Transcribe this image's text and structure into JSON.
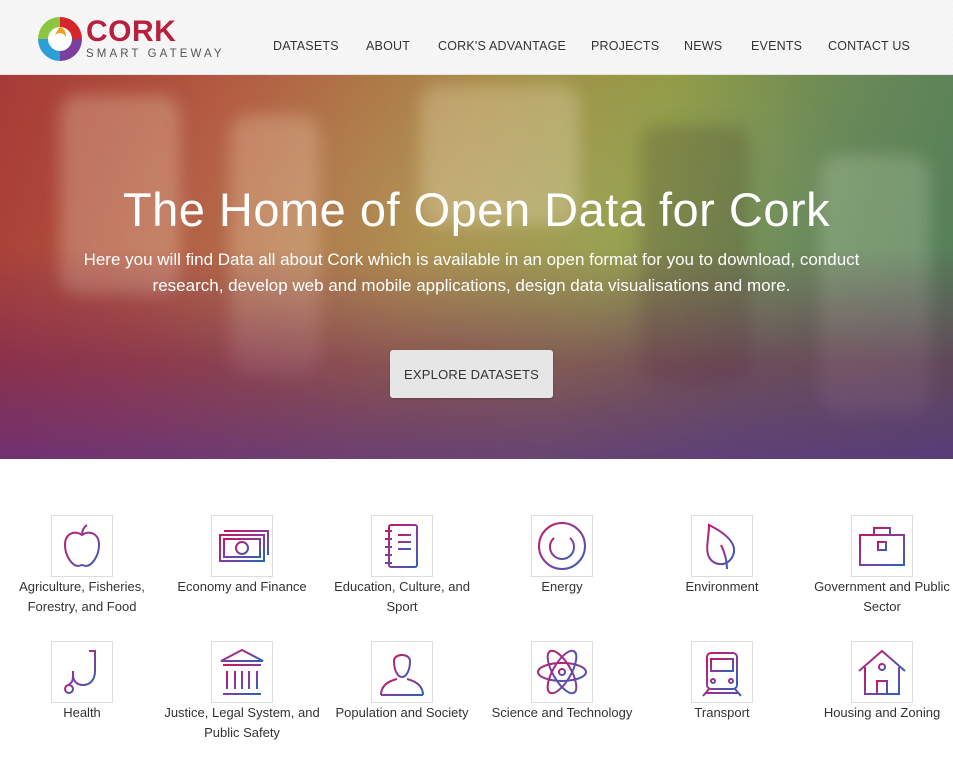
{
  "header": {
    "logo": {
      "word": "CORK",
      "sub": "SMART GATEWAY"
    },
    "nav": [
      {
        "label": "DATASETS"
      },
      {
        "label": "ABOUT"
      },
      {
        "label": "CORK'S ADVANTAGE"
      },
      {
        "label": "PROJECTS"
      },
      {
        "label": "NEWS"
      },
      {
        "label": "EVENTS"
      },
      {
        "label": "CONTACT US"
      }
    ]
  },
  "hero": {
    "title": "The Home of Open Data for Cork",
    "text": "Here you will find Data all about Cork which is available in an open format for you to download, conduct research, develop web and mobile applications, design data visualisations and more.",
    "button": "EXPLORE DATASETS"
  },
  "categories": [
    {
      "label": "Agriculture, Fisheries, Forestry, and Food",
      "icon": "apple-icon"
    },
    {
      "label": "Economy and Finance",
      "icon": "banknote-icon"
    },
    {
      "label": "Education, Culture, and Sport",
      "icon": "notebook-icon"
    },
    {
      "label": "Energy",
      "icon": "power-icon"
    },
    {
      "label": "Environment",
      "icon": "leaf-icon"
    },
    {
      "label": "Government and Public Sector",
      "icon": "briefcase-icon"
    },
    {
      "label": "Health",
      "icon": "stethoscope-icon"
    },
    {
      "label": "Justice, Legal System, and Public Safety",
      "icon": "courthouse-icon"
    },
    {
      "label": "Population and Society",
      "icon": "person-icon"
    },
    {
      "label": "Science and Technology",
      "icon": "atom-icon"
    },
    {
      "label": "Transport",
      "icon": "train-icon"
    },
    {
      "label": "Housing and Zoning",
      "icon": "house-icon"
    }
  ],
  "colors": {
    "brand_red": "#b8203f",
    "icon_gradient_start": "#c2185b",
    "icon_gradient_end": "#2a63b8"
  }
}
